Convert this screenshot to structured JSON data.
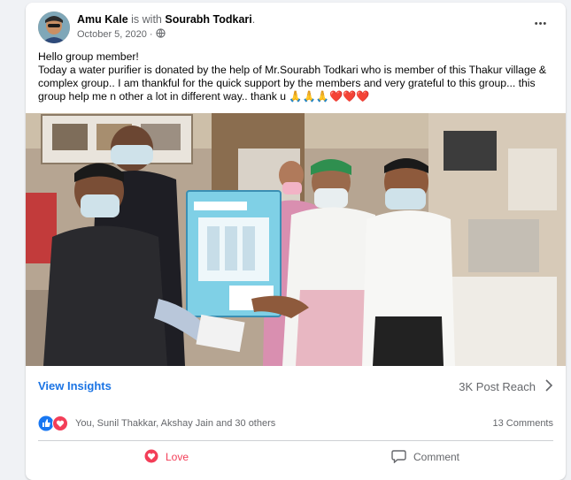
{
  "post": {
    "author": "Amu Kale",
    "with_text": "is with",
    "tagged": "Sourabh Todkari",
    "tagged_suffix": ".",
    "date": "October 5, 2020",
    "separator": "·",
    "privacy_icon": "globe-icon",
    "more_icon": "more-horizontal-icon",
    "more_label": "•••",
    "text_line1": "Hello group member!",
    "text_line2": "Today a water purifier is donated by the help of Mr.Sourabh Todkari who is member of this Thakur village & complex group.. I am thankful for the quick support by the members and very grateful to this group... this group help me n other a lot in different way.. thank u 🙏🙏🙏❤️❤️❤️"
  },
  "insights": {
    "link": "View Insights",
    "reach": "3K Post Reach",
    "chevron_icon": "chevron-right-icon"
  },
  "reactions": {
    "icons": [
      "like-icon",
      "love-icon"
    ],
    "names": "You, Sunil Thakkar, Akshay Jain and 30 others",
    "comments": "13 Comments"
  },
  "actions": {
    "love": "Love",
    "comment": "Comment"
  },
  "colors": {
    "accent_blue": "#1b74e4",
    "love_red": "#f33e58",
    "muted_text": "#65676b",
    "background": "#f0f2f5"
  }
}
